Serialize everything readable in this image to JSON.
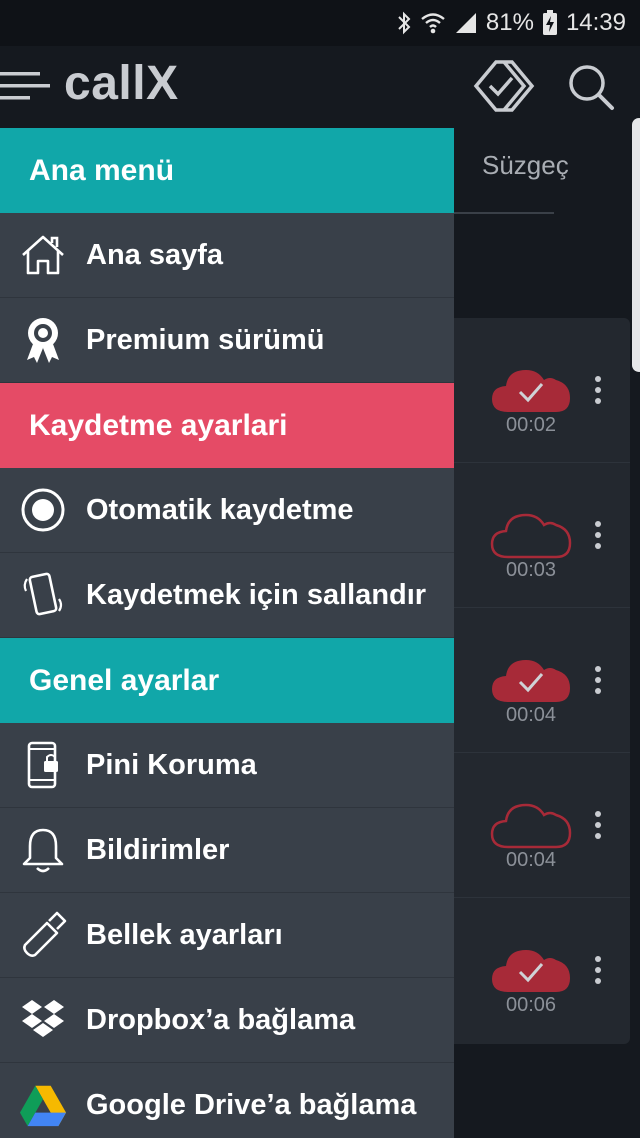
{
  "status_bar": {
    "battery": "81%",
    "time": "14:39",
    "icons": [
      "bluetooth-icon",
      "wifi-icon",
      "signal-icon",
      "battery-charging-icon"
    ]
  },
  "app_bar": {
    "title": "callX",
    "icons": [
      "menu-icon",
      "check-stack-icon",
      "search-icon"
    ]
  },
  "background": {
    "filter_tab": "Süzgeç",
    "records": [
      {
        "duration": "00:02",
        "cloud": "uploaded"
      },
      {
        "duration": "00:03",
        "cloud": "not-uploaded"
      },
      {
        "duration": "00:04",
        "cloud": "uploaded"
      },
      {
        "duration": "00:04",
        "cloud": "not-uploaded"
      },
      {
        "duration": "00:06",
        "cloud": "uploaded"
      }
    ]
  },
  "drawer": {
    "main_header": "Ana menü",
    "main_items": [
      {
        "label": "Ana sayfa",
        "icon": "home-icon"
      },
      {
        "label": "Premium sürümü",
        "icon": "award-ribbon-icon"
      }
    ],
    "recording_header": "Kaydetme ayarlari",
    "recording_items": [
      {
        "label": "Otomatik kaydetme",
        "icon": "radio-record-icon"
      },
      {
        "label": "Kaydetmek için sallandır",
        "icon": "shake-phone-icon"
      }
    ],
    "general_header": "Genel ayarlar",
    "general_items": [
      {
        "label": "Pini Koruma",
        "icon": "phone-lock-icon"
      },
      {
        "label": "Bildirimler",
        "icon": "bell-icon"
      },
      {
        "label": "Bellek ayarları",
        "icon": "usb-stick-icon"
      },
      {
        "label": "Dropbox’a bağlama",
        "icon": "dropbox-icon"
      },
      {
        "label": "Google Drive’a bağlama",
        "icon": "google-drive-icon"
      }
    ]
  },
  "colors": {
    "teal": "#11a7a9",
    "red": "#e54b66",
    "drawer_bg": "#394049",
    "cloud_red": "#a72a38"
  }
}
